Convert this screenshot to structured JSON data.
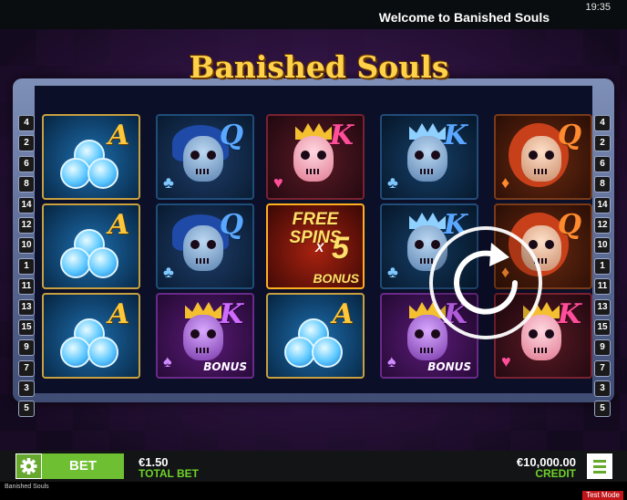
{
  "status_bar": {
    "time": "19:35",
    "welcome": "Welcome to Banished Souls"
  },
  "game": {
    "title": "Banished Souls",
    "paylines_left": [
      "4",
      "2",
      "6",
      "8",
      "14",
      "12",
      "10",
      "1",
      "11",
      "13",
      "15",
      "9",
      "7",
      "3",
      "5"
    ],
    "paylines_right": [
      "4",
      "2",
      "6",
      "8",
      "14",
      "12",
      "10",
      "1",
      "11",
      "13",
      "15",
      "9",
      "7",
      "3",
      "5"
    ],
    "reels": [
      [
        {
          "symbol": "club-ace",
          "letter": "A"
        },
        {
          "symbol": "club-ace",
          "letter": "A"
        },
        {
          "symbol": "club-ace",
          "letter": "A"
        }
      ],
      [
        {
          "symbol": "blue-queen",
          "letter": "Q"
        },
        {
          "symbol": "blue-queen",
          "letter": "Q"
        },
        {
          "symbol": "purple-king-bonus",
          "letter": "K",
          "bonus": "BONUS"
        }
      ],
      [
        {
          "symbol": "pink-king",
          "letter": "K"
        },
        {
          "symbol": "free-spins",
          "text": "FREE SPINS",
          "multiplier_x": "X",
          "multiplier": "5",
          "bonus": "BONUS"
        },
        {
          "symbol": "club-ace",
          "letter": "A"
        }
      ],
      [
        {
          "symbol": "blue-king",
          "letter": "K"
        },
        {
          "symbol": "blue-king",
          "letter": "K"
        },
        {
          "symbol": "purple-king-bonus",
          "letter": "K",
          "bonus": "BONUS"
        }
      ],
      [
        {
          "symbol": "red-queen",
          "letter": "Q"
        },
        {
          "symbol": "red-queen",
          "letter": "Q"
        },
        {
          "symbol": "pink-king",
          "letter": "K"
        }
      ]
    ],
    "spin_icon": "spin-icon"
  },
  "bottom_bar": {
    "settings_icon": "gear-icon",
    "bet_label": "BET",
    "total_bet_amount": "€1.50",
    "total_bet_label": "TOTAL BET",
    "credit_amount": "€10,000.00",
    "credit_label": "CREDIT",
    "menu_icon": "hamburger-menu-icon"
  },
  "footer": {
    "game_name": "Banished Souls",
    "mode": "Test Mode"
  },
  "colors": {
    "accent_green": "#6fbf32",
    "credit_green": "#6fd12a",
    "test_mode_red": "#c0161a"
  }
}
